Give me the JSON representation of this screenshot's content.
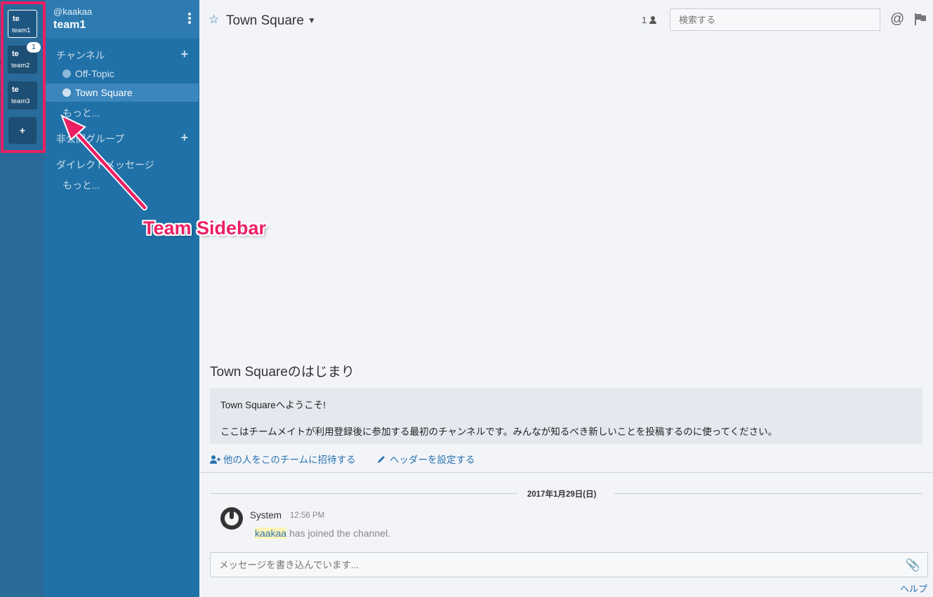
{
  "teams": [
    {
      "abbr": "te",
      "name": "team1",
      "active": true
    },
    {
      "abbr": "te",
      "name": "team2",
      "badge": "1"
    },
    {
      "abbr": "te",
      "name": "team3"
    }
  ],
  "team_add_label": "+",
  "sidebar": {
    "username": "@kaakaa",
    "team_name": "team1",
    "channels_title": "チャンネル",
    "channels": [
      {
        "label": "Off-Topic",
        "active": false
      },
      {
        "label": "Town Square",
        "active": true
      }
    ],
    "more_channels": "もっと...",
    "private_title": "非公開グループ",
    "dm_title": "ダイレクトメッセージ",
    "more_dm": "もっと..."
  },
  "header": {
    "channel_name": "Town Square",
    "member_count": "1",
    "search_placeholder": "検索する",
    "mentions_symbol": "@"
  },
  "intro": {
    "title": "Town Squareのはじまり",
    "welcome": "Town Squareへようこそ!",
    "description": "ここはチームメイトが利用登録後に参加する最初のチャンネルです。みんなが知るべき新しいことを投稿するのに使ってください。",
    "invite_link": "他の人をこのチームに招待する",
    "header_link": "ヘッダーを設定する"
  },
  "posts": {
    "date_separator": "2017年1月29日(日)",
    "items": [
      {
        "author": "System",
        "time": "12:56 PM",
        "mention": "kaakaa",
        "text": " has joined the channel."
      }
    ]
  },
  "composer": {
    "placeholder": "メッセージを書き込んでいます..."
  },
  "help_link": "ヘルプ",
  "annotation": {
    "label": "Team Sidebar",
    "color": "#ec1f64"
  },
  "colors": {
    "team_sidebar": "#286a99",
    "channel_sidebar": "#2071a7",
    "link": "#2a73b0",
    "center_bg": "#f2f4f8"
  }
}
